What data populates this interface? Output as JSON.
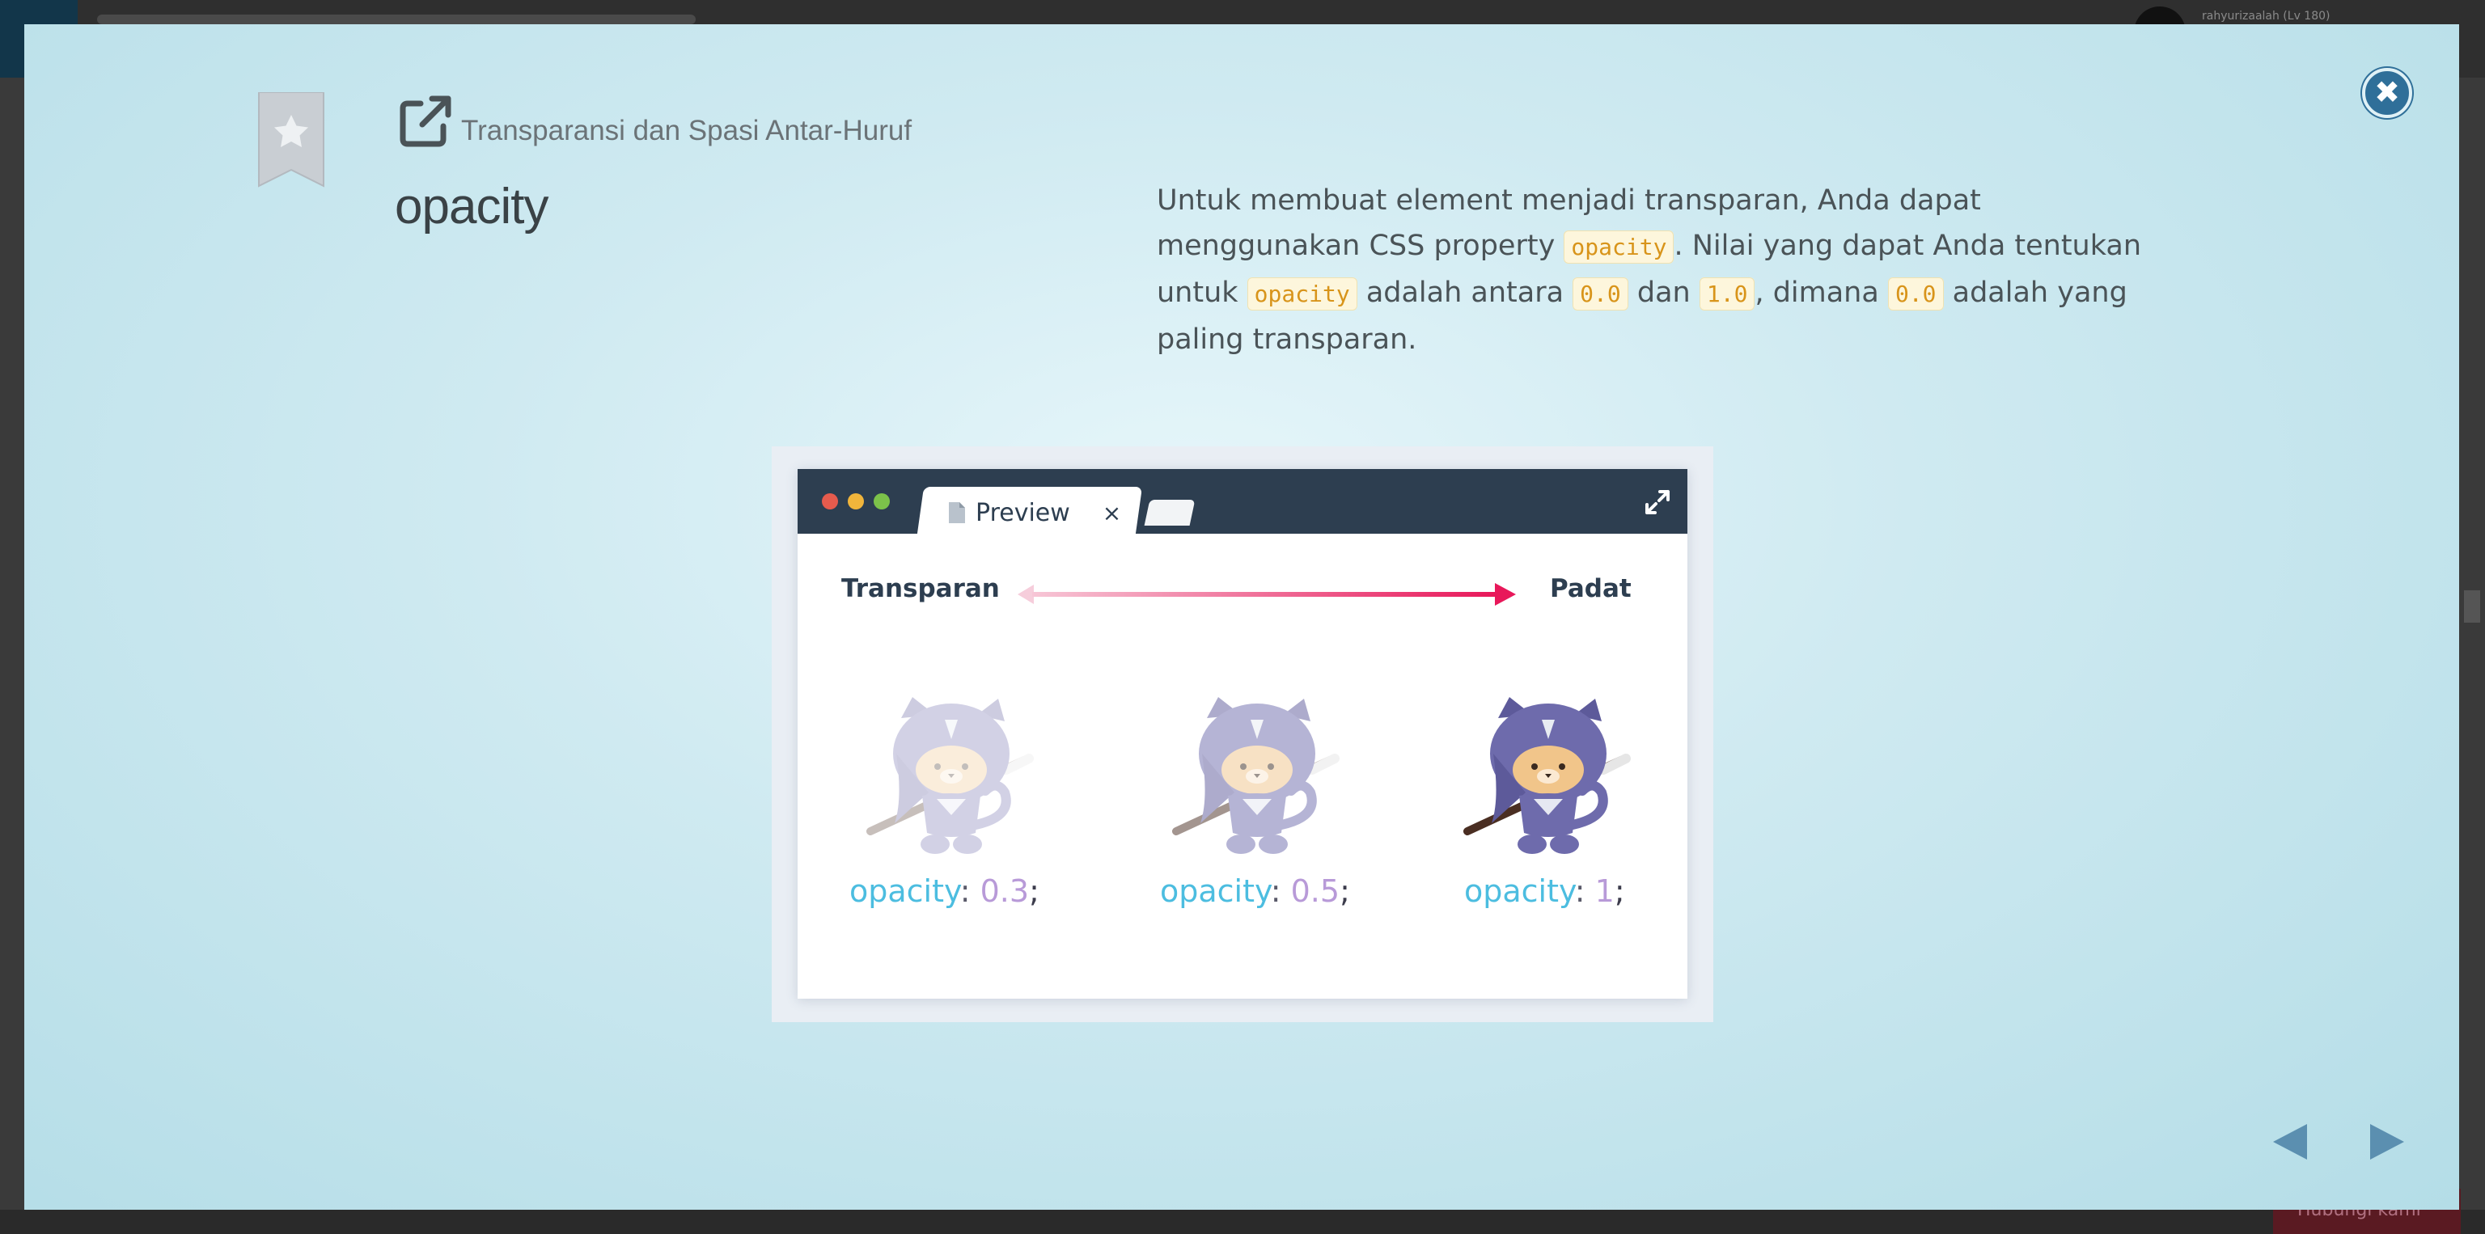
{
  "background_page": {
    "username": "rahyurizaalah (Lv 180)",
    "bottom_button_label": "Hubungi kami"
  },
  "modal": {
    "chapter_title": "Transparansi dan Spasi Antar-Huruf",
    "lesson_title": "opacity",
    "description": {
      "part1": "Untuk membuat element menjadi transparan, Anda dapat menggunakan CSS property ",
      "code1": "opacity",
      "part2": ". Nilai yang dapat Anda tentukan untuk ",
      "code2": "opacity",
      "part3": " adalah antara ",
      "code3": "0.0",
      "part4": " dan ",
      "code4": "1.0",
      "part5": ", dimana ",
      "code5": "0.0",
      "part6": " adalah yang paling transparan."
    },
    "illustration": {
      "tab_label": "Preview",
      "tab_close": "×",
      "left_label": "Transparan",
      "right_label": "Padat",
      "examples": [
        {
          "property": "opacity",
          "colon": ": ",
          "value": "0.3",
          "semicolon": ";"
        },
        {
          "property": "opacity",
          "colon": ": ",
          "value": "0.5",
          "semicolon": ";"
        },
        {
          "property": "opacity",
          "colon": ": ",
          "value": "1",
          "semicolon": ";"
        }
      ]
    },
    "icons": {
      "close": "close-icon",
      "bookmark": "bookmark-star-icon",
      "external_link": "external-link-icon",
      "prev": "arrow-left-icon",
      "next": "arrow-right-icon",
      "expand": "expand-icon"
    },
    "colors": {
      "accent": "#2f6f99",
      "nav_arrows": "#5b8fb0",
      "code_text": "#d8941a",
      "code_bg": "#fdf6dc",
      "arrow_gradient_end": "#e8185a"
    }
  }
}
